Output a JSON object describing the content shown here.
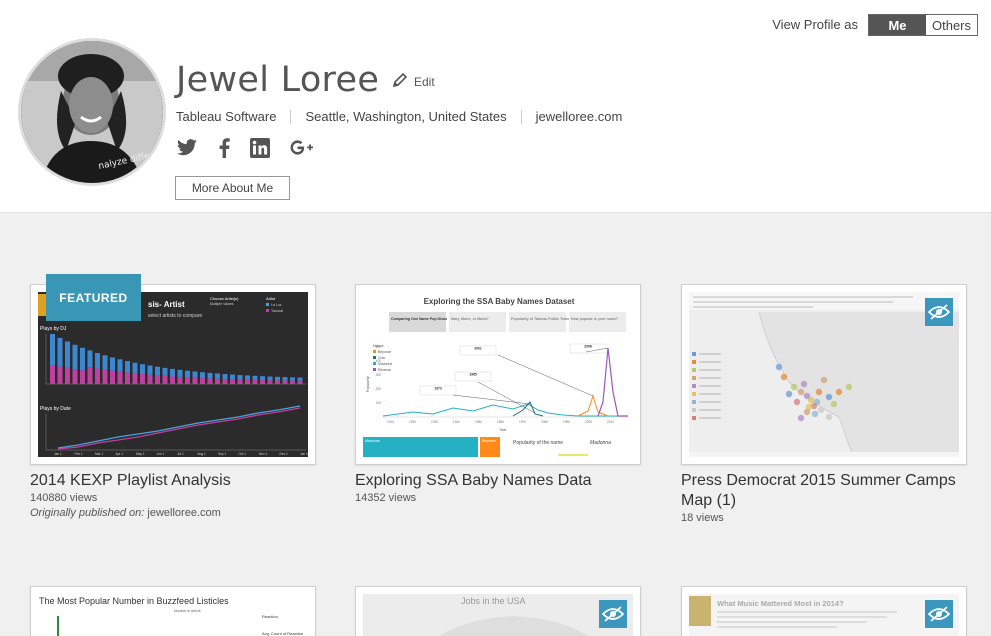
{
  "profile": {
    "name": "Jewel Loree",
    "edit_label": "Edit",
    "organization": "Tableau Software",
    "location": "Seattle, Washington, United States",
    "website": "jewelloree.com",
    "more_button": "More About Me",
    "avatar_shirt_text": "nalyze different."
  },
  "view_as": {
    "label": "View Profile as",
    "options": [
      "Me",
      "Others"
    ],
    "selected": "Me"
  },
  "social_icons": [
    "twitter-icon",
    "facebook-icon",
    "linkedin-icon",
    "google-plus-icon"
  ],
  "colors": {
    "accent": "#3a96b5",
    "toggle_active": "#555555",
    "background": "#f0f0f0"
  },
  "featured_label": "FEATURED",
  "published_label": "Originally published on:",
  "cards": [
    {
      "title": "2014 KEXP Playlist Analysis",
      "views": "140880 views",
      "published_on": "jewelloree.com",
      "thumb": {
        "title_fragment": "sis- Artist",
        "subtitle_fragment": "select artists to compare",
        "filter_label": "Choose Artist(s)",
        "filter_value": "Multiple Values",
        "legend_title": "Artist",
        "legend_items": [
          "La Luz",
          "Tacocat"
        ],
        "panel1": "Plays by DJ",
        "panel2": "Plays by Date",
        "axis_ticks": [
          "Jan 1",
          "Feb 1",
          "Mar 1",
          "Apr 1",
          "May 1",
          "Jun 1",
          "Jul 1",
          "Aug 1",
          "Sep 1",
          "Oct 1",
          "Nov 1",
          "Dec 1",
          "Jan 1"
        ]
      }
    },
    {
      "title": "Exploring SSA Baby Names Data",
      "views": "14352 views",
      "thumb": {
        "title": "Exploring the SSA Baby Names Dataset",
        "tabs": [
          "Comparing One Name Pop Divas",
          "Mary, Marie, or Maria?",
          "Popularity of Tableau Public Team Names",
          "How popular is your name?"
        ],
        "legend_title": "Name",
        "legend": [
          "Beyonce",
          "Cher",
          "Madonna",
          "Rihanna"
        ],
        "annotations": [
          "1973",
          "1985",
          "2001",
          "2008"
        ],
        "x_ticks": [
          "1910",
          "1920",
          "1930",
          "1940",
          "1950",
          "1960",
          "1970",
          "1980",
          "1990",
          "2000",
          "2010"
        ],
        "y_ticks": [
          "100",
          "200",
          "300",
          "400",
          "500"
        ],
        "y_label": "Popularity",
        "x_label": "Year",
        "bottom_left": "Madonna",
        "bottom_right": "Beyonce",
        "popularity_label": "Popularity of the name",
        "popularity_name": "Madonna"
      }
    },
    {
      "title": "Press Democrat 2015 Summer Camps Map (1)",
      "views": "18 views",
      "hidden": true
    }
  ],
  "bottom_cards": [
    {
      "thumb_title": "The Most Popular Number in Buzzfeed Listicles",
      "subtitle": "Number in Article",
      "legend": "Reaction",
      "legend_sub": "Avg. Count of Reaction"
    },
    {
      "thumb_title": "Jobs in the USA",
      "hidden": true
    },
    {
      "thumb_title": "What Music Mattered Most in 2014?",
      "hidden": true
    }
  ]
}
